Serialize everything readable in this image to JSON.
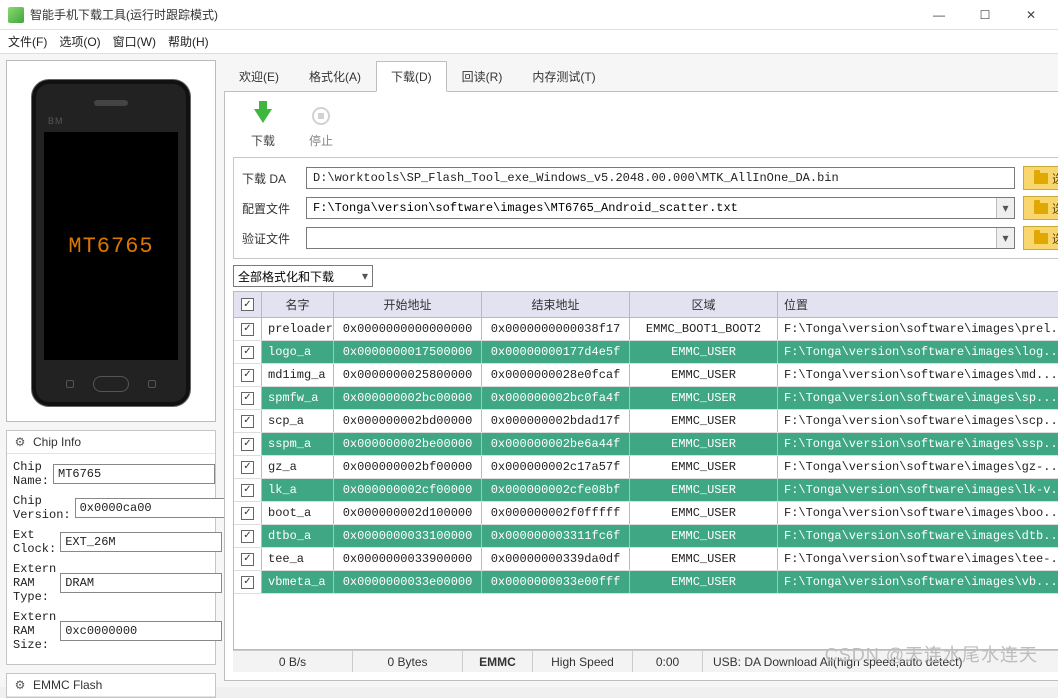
{
  "window": {
    "title": "智能手机下载工具(运行时跟踪模式)"
  },
  "menu": {
    "file": "文件(F)",
    "options": "选项(O)",
    "window": "窗口(W)",
    "help": "帮助(H)"
  },
  "phone": {
    "bm": "BM",
    "chip": "MT6765"
  },
  "chipinfo": {
    "heading": "Chip Info",
    "rows": {
      "name_l": "Chip Name:",
      "name_v": "MT6765",
      "ver_l": "Chip Version:",
      "ver_v": "0x0000ca00",
      "clk_l": "Ext Clock:",
      "clk_v": "EXT_26M",
      "ram_l": "Extern RAM Type:",
      "ram_v": "DRAM",
      "rsz_l": "Extern RAM Size:",
      "rsz_v": "0xc0000000"
    }
  },
  "emmc": {
    "heading": "EMMC Flash"
  },
  "tabs": {
    "welcome": "欢迎(E)",
    "format": "格式化(A)",
    "download": "下载(D)",
    "readback": "回读(R)",
    "memtest": "内存测试(T)"
  },
  "toolbar": {
    "download": "下载",
    "stop": "停止"
  },
  "files": {
    "da_l": "下载 DA",
    "da_v": "D:\\worktools\\SP_Flash_Tool_exe_Windows_v5.2048.00.000\\MTK_AllInOne_DA.bin",
    "cfg_l": "配置文件",
    "cfg_v": "F:\\Tonga\\version\\software\\images\\MT6765_Android_scatter.txt",
    "ver_l": "验证文件",
    "ver_v": "",
    "choose": "选择"
  },
  "action": "全部格式化和下载",
  "grid": {
    "h_name": "名字",
    "h_start": "开始地址",
    "h_end": "结束地址",
    "h_region": "区域",
    "h_loc": "位置",
    "rows": [
      {
        "hl": 0,
        "n": "preloader",
        "s": "0x0000000000000000",
        "e": "0x0000000000038f17",
        "r": "EMMC_BOOT1_BOOT2",
        "l": "F:\\Tonga\\version\\software\\images\\prel..."
      },
      {
        "hl": 1,
        "n": "logo_a",
        "s": "0x0000000017500000",
        "e": "0x00000000177d4e5f",
        "r": "EMMC_USER",
        "l": "F:\\Tonga\\version\\software\\images\\log..."
      },
      {
        "hl": 0,
        "n": "md1img_a",
        "s": "0x0000000025800000",
        "e": "0x0000000028e0fcaf",
        "r": "EMMC_USER",
        "l": "F:\\Tonga\\version\\software\\images\\md..."
      },
      {
        "hl": 1,
        "n": "spmfw_a",
        "s": "0x000000002bc00000",
        "e": "0x000000002bc0fa4f",
        "r": "EMMC_USER",
        "l": "F:\\Tonga\\version\\software\\images\\sp..."
      },
      {
        "hl": 0,
        "n": "scp_a",
        "s": "0x000000002bd00000",
        "e": "0x000000002bdad17f",
        "r": "EMMC_USER",
        "l": "F:\\Tonga\\version\\software\\images\\scp..."
      },
      {
        "hl": 1,
        "n": "sspm_a",
        "s": "0x000000002be00000",
        "e": "0x000000002be6a44f",
        "r": "EMMC_USER",
        "l": "F:\\Tonga\\version\\software\\images\\ssp..."
      },
      {
        "hl": 0,
        "n": "gz_a",
        "s": "0x000000002bf00000",
        "e": "0x000000002c17a57f",
        "r": "EMMC_USER",
        "l": "F:\\Tonga\\version\\software\\images\\gz-..."
      },
      {
        "hl": 1,
        "n": "lk_a",
        "s": "0x000000002cf00000",
        "e": "0x000000002cfe08bf",
        "r": "EMMC_USER",
        "l": "F:\\Tonga\\version\\software\\images\\lk-v..."
      },
      {
        "hl": 0,
        "n": "boot_a",
        "s": "0x000000002d100000",
        "e": "0x000000002f0fffff",
        "r": "EMMC_USER",
        "l": "F:\\Tonga\\version\\software\\images\\boo..."
      },
      {
        "hl": 1,
        "n": "dtbo_a",
        "s": "0x0000000033100000",
        "e": "0x000000003311fc6f",
        "r": "EMMC_USER",
        "l": "F:\\Tonga\\version\\software\\images\\dtb..."
      },
      {
        "hl": 0,
        "n": "tee_a",
        "s": "0x0000000033900000",
        "e": "0x00000000339da0df",
        "r": "EMMC_USER",
        "l": "F:\\Tonga\\version\\software\\images\\tee-..."
      },
      {
        "hl": 1,
        "n": "vbmeta_a",
        "s": "0x0000000033e00000",
        "e": "0x0000000033e00fff",
        "r": "EMMC_USER",
        "l": "F:\\Tonga\\version\\software\\images\\vb..."
      }
    ]
  },
  "status": {
    "rate": "0 B/s",
    "bytes": "0 Bytes",
    "storage": "EMMC",
    "speed": "High Speed",
    "time": "0:00",
    "usb": "USB: DA Download All(high speed,auto detect)"
  },
  "watermark": "CSDN @天连水尾水连天"
}
